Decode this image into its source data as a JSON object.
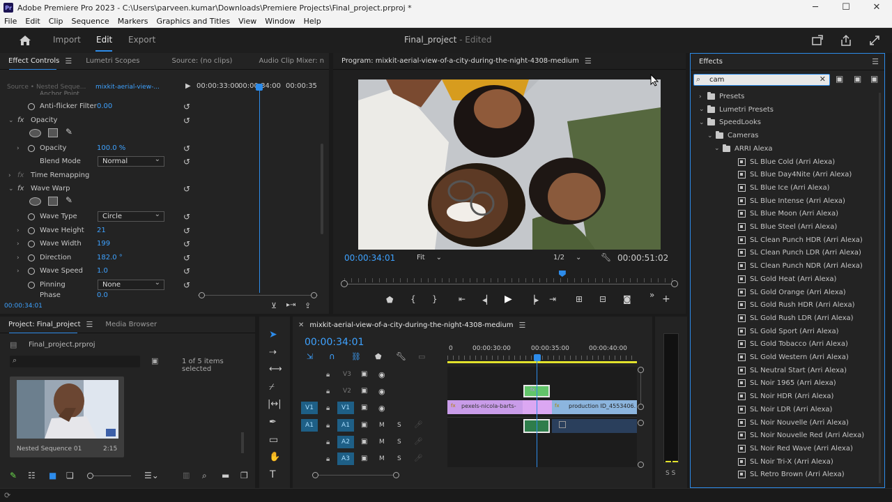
{
  "titlebar": {
    "app_icon": "Pr",
    "title": "Adobe Premiere Pro 2023 - C:\\Users\\parveen.kumar\\Downloads\\Premiere Projects\\Final_project.prproj *",
    "min": "─",
    "max": "☐",
    "close": "✕"
  },
  "menu": [
    "File",
    "Edit",
    "Clip",
    "Sequence",
    "Markers",
    "Graphics and Titles",
    "View",
    "Window",
    "Help"
  ],
  "workspace": {
    "import": "Import",
    "edit": "Edit",
    "export": "Export",
    "project_name": "Final_project",
    "edited": " - Edited"
  },
  "effect_controls": {
    "tabs": [
      "Effect Controls",
      "Lumetri Scopes",
      "Source: (no clips)",
      "Audio Clip Mixer: n"
    ],
    "source_label": "Source • Nested Seque...",
    "clip_label": "mixkit-aerial-view-...",
    "ruler": [
      "00:00:33:00",
      "00:00:34:00",
      "00:00:35"
    ],
    "anchor_partial": "Anchor Point",
    "anti_flicker": {
      "name": "Anti-flicker Filter",
      "value": "0.00"
    },
    "opacity_section": "Opacity",
    "opacity": {
      "name": "Opacity",
      "value": "100.0 %"
    },
    "blend_mode": {
      "name": "Blend Mode",
      "value": "Normal"
    },
    "time_remap": "Time Remapping",
    "wave_warp": "Wave Warp",
    "wave_type": {
      "name": "Wave Type",
      "value": "Circle"
    },
    "wave_height": {
      "name": "Wave Height",
      "value": "21"
    },
    "wave_width": {
      "name": "Wave Width",
      "value": "199"
    },
    "direction": {
      "name": "Direction",
      "value": "182.0 °"
    },
    "wave_speed": {
      "name": "Wave Speed",
      "value": "1.0"
    },
    "pinning": {
      "name": "Pinning",
      "value": "None"
    },
    "phase_partial": {
      "name": "Phase",
      "value": "0.0"
    },
    "timecode": "00:00:34:01"
  },
  "program": {
    "title": "Program: mixkit-aerial-view-of-a-city-during-the-night-4308-medium",
    "timecode": "00:00:34:01",
    "fit": "Fit",
    "resolution": "1/2",
    "duration": "00:00:51:02",
    "playhead": 0.66
  },
  "effects": {
    "title": "Effects",
    "search_value": "cam",
    "tree": [
      {
        "label": "Presets",
        "level": 0,
        "type": "folder",
        "arrow": "›"
      },
      {
        "label": "Lumetri Presets",
        "level": 0,
        "type": "folder",
        "arrow": "⌄"
      },
      {
        "label": "SpeedLooks",
        "level": 1,
        "type": "folder",
        "arrow": "⌄"
      },
      {
        "label": "Cameras",
        "level": 2,
        "type": "folder",
        "arrow": "⌄"
      },
      {
        "label": "ARRI Alexa",
        "level": 3,
        "type": "folder",
        "arrow": "⌄"
      },
      {
        "label": "SL Blue Cold (Arri Alexa)",
        "level": 4,
        "type": "preset"
      },
      {
        "label": "SL Blue Day4Nite (Arri Alexa)",
        "level": 4,
        "type": "preset"
      },
      {
        "label": "SL Blue Ice (Arri Alexa)",
        "level": 4,
        "type": "preset"
      },
      {
        "label": "SL Blue Intense (Arri Alexa)",
        "level": 4,
        "type": "preset"
      },
      {
        "label": "SL Blue Moon (Arri Alexa)",
        "level": 4,
        "type": "preset"
      },
      {
        "label": "SL Blue Steel (Arri Alexa)",
        "level": 4,
        "type": "preset"
      },
      {
        "label": "SL Clean Punch HDR (Arri Alexa)",
        "level": 4,
        "type": "preset"
      },
      {
        "label": "SL Clean Punch LDR (Arri Alexa)",
        "level": 4,
        "type": "preset"
      },
      {
        "label": "SL Clean Punch NDR (Arri Alexa)",
        "level": 4,
        "type": "preset"
      },
      {
        "label": "SL Gold Heat (Arri Alexa)",
        "level": 4,
        "type": "preset"
      },
      {
        "label": "SL Gold Orange (Arri Alexa)",
        "level": 4,
        "type": "preset"
      },
      {
        "label": "SL Gold Rush HDR (Arri Alexa)",
        "level": 4,
        "type": "preset"
      },
      {
        "label": "SL Gold Rush LDR (Arri Alexa)",
        "level": 4,
        "type": "preset"
      },
      {
        "label": "SL Gold Sport (Arri Alexa)",
        "level": 4,
        "type": "preset"
      },
      {
        "label": "SL Gold Tobacco (Arri Alexa)",
        "level": 4,
        "type": "preset"
      },
      {
        "label": "SL Gold Western (Arri Alexa)",
        "level": 4,
        "type": "preset"
      },
      {
        "label": "SL Neutral Start (Arri Alexa)",
        "level": 4,
        "type": "preset"
      },
      {
        "label": "SL Noir 1965 (Arri Alexa)",
        "level": 4,
        "type": "preset"
      },
      {
        "label": "SL Noir HDR (Arri Alexa)",
        "level": 4,
        "type": "preset"
      },
      {
        "label": "SL Noir LDR (Arri Alexa)",
        "level": 4,
        "type": "preset"
      },
      {
        "label": "SL Noir Nouvelle (Arri Alexa)",
        "level": 4,
        "type": "preset"
      },
      {
        "label": "SL Noir Nouvelle Red (Arri Alexa)",
        "level": 4,
        "type": "preset"
      },
      {
        "label": "SL Noir Red Wave (Arri Alexa)",
        "level": 4,
        "type": "preset"
      },
      {
        "label": "SL Noir Tri-X (Arri Alexa)",
        "level": 4,
        "type": "preset"
      },
      {
        "label": "SL Retro Brown (Arri Alexa)",
        "level": 4,
        "type": "preset"
      }
    ]
  },
  "project": {
    "tabs": [
      "Project: Final_project",
      "Media Browser"
    ],
    "file": "Final_project.prproj",
    "items_count": "1 of 5 items selected",
    "thumb_name": "Nested Sequence 01",
    "thumb_duration": "2:15"
  },
  "timeline": {
    "title": "mixkit-aerial-view-of-a-city-during-the-night-4308-medium",
    "timecode": "00:00:34:01",
    "ruler": [
      "0",
      "00:00:30:00",
      "00:00:35:00",
      "00:00:40:00"
    ],
    "video_tracks": [
      {
        "target": "",
        "name": "V3"
      },
      {
        "target": "",
        "name": "V2"
      },
      {
        "target": "V1",
        "name": "V1"
      }
    ],
    "audio_tracks": [
      {
        "target": "A1",
        "name": "A1",
        "m": "M",
        "s": "S"
      },
      {
        "target": "",
        "name": "A2",
        "m": "M",
        "s": "S"
      },
      {
        "target": "",
        "name": "A3",
        "m": "M",
        "s": "S"
      }
    ],
    "clip_v1_a": "pexels-nicola-barts-",
    "clip_v1_b": "production ID_4553406.",
    "meter_labels": "S S"
  },
  "colors": {
    "accent": "#2d8ceb",
    "value_blue": "#3ea2ff",
    "clip_violet": "#c99ce9",
    "clip_blue": "#8cb5de",
    "clip_green": "#62c46a",
    "audio_green": "#2e7d4b",
    "yellow_bar": "#e2e22b"
  }
}
